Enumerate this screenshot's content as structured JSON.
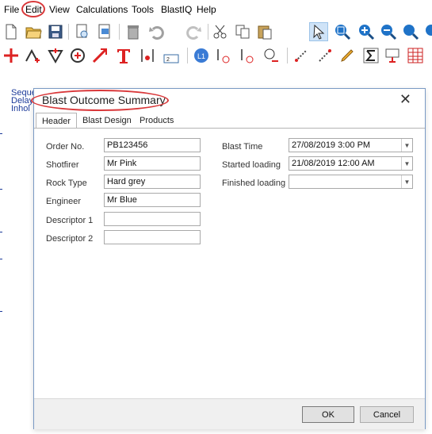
{
  "menu": {
    "file": "File",
    "edit": "Edit",
    "view": "View",
    "calculations": "Calculations",
    "tools": "Tools",
    "blastiq": "BlastIQ",
    "help": "Help"
  },
  "background_text": [
    "Seque",
    "Delay",
    "Inhol"
  ],
  "dialog": {
    "title": "Blast Outcome Summary",
    "tabs": [
      "Header",
      "Blast Design",
      "Products"
    ],
    "fields": {
      "order_no": {
        "label": "Order No.",
        "value": "PB123456"
      },
      "shotfirer": {
        "label": "Shotfirer",
        "value": "Mr Pink"
      },
      "rock_type": {
        "label": "Rock Type",
        "value": "Hard grey"
      },
      "engineer": {
        "label": "Engineer",
        "value": "Mr Blue"
      },
      "descriptor1": {
        "label": "Descriptor 1",
        "value": ""
      },
      "descriptor2": {
        "label": "Descriptor 2",
        "value": ""
      },
      "blast_time": {
        "label": "Blast Time",
        "value": "27/08/2019 3:00 PM"
      },
      "started_loading": {
        "label": "Started loading",
        "value": "21/08/2019 12:00 AM"
      },
      "finished_loading": {
        "label": "Finished loading",
        "value": ""
      }
    },
    "ok": "OK",
    "cancel": "Cancel"
  },
  "colors": {
    "highlight_circle": "#d9383a",
    "dialog_border": "#7a9ac4",
    "background_text": "#1d3b9a"
  }
}
